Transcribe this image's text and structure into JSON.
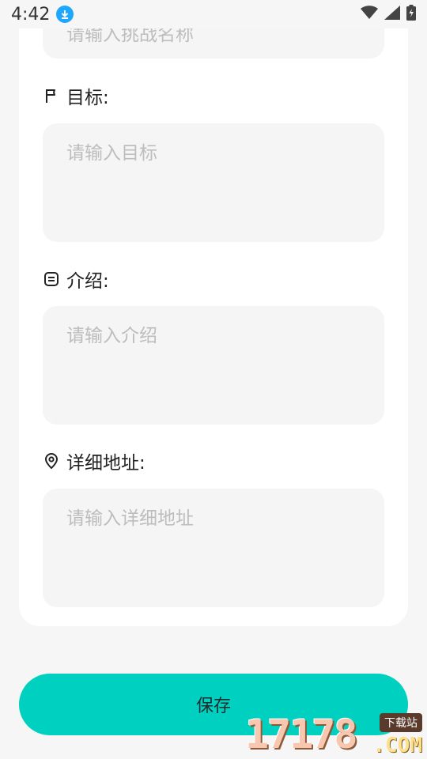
{
  "status_bar": {
    "time": "4:42"
  },
  "form": {
    "name_placeholder": "请输入挑战名称",
    "goal": {
      "label": "目标:",
      "placeholder": "请输入目标"
    },
    "intro": {
      "label": "介绍:",
      "placeholder": "请输入介绍"
    },
    "address": {
      "label": "详细地址:",
      "placeholder": "请输入详细地址"
    }
  },
  "save_button": {
    "label": "保存"
  },
  "watermark": {
    "number": "17178",
    "domain": ".COM",
    "tag": "下载站"
  },
  "colors": {
    "accent": "#00d0c0",
    "input_bg": "#f5f5f5",
    "placeholder": "#bdbdbd"
  }
}
